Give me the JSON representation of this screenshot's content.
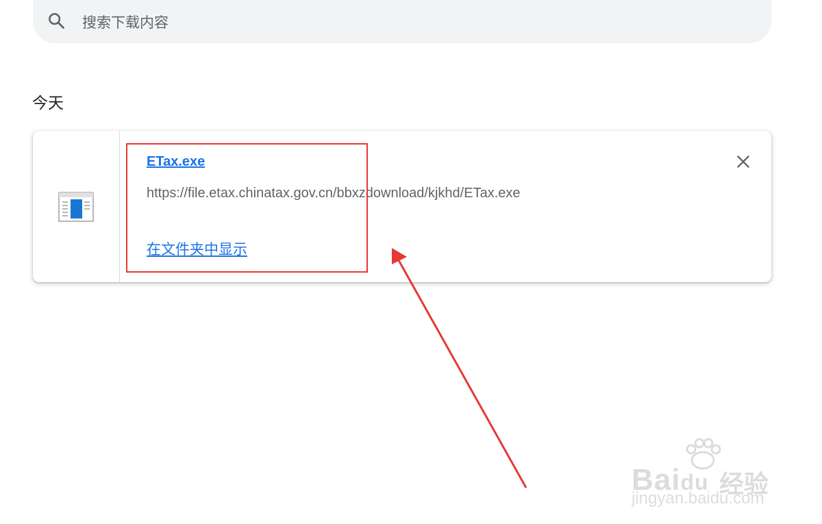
{
  "search": {
    "placeholder": "搜索下载内容",
    "icon": "search-icon"
  },
  "section": {
    "title": "今天"
  },
  "download": {
    "file_name": "ETax.exe",
    "url": "https://file.etax.chinatax.gov.cn/bbxzdownload/kjkhd/ETax.exe",
    "show_in_folder": "在文件夹中显示",
    "file_icon": "app-window-icon",
    "close_icon": "close-icon"
  },
  "annotation": {
    "highlight_color": "#e53935"
  },
  "watermark": {
    "brand": "Bai",
    "brand_suffix": "du",
    "cn": "经验",
    "url": "jingyan.baidu.com"
  },
  "colors": {
    "link": "#1a73e8",
    "secondary_text": "#5f6368",
    "search_bg": "#f1f3f4"
  }
}
